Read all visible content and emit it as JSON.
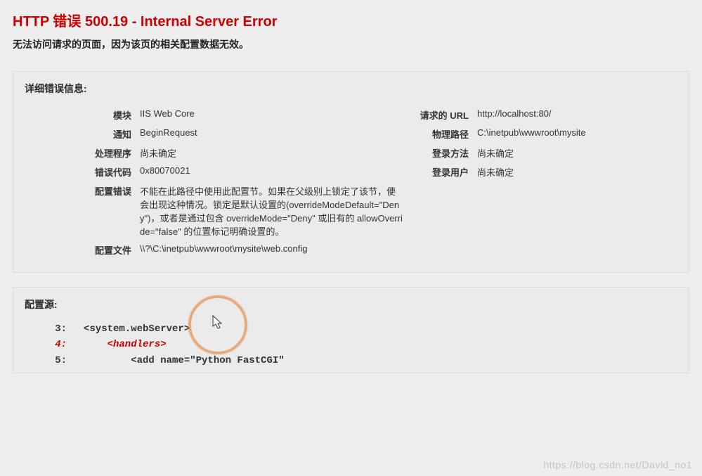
{
  "title": "HTTP 错误 500.19 - Internal Server Error",
  "subtitle": "无法访问请求的页面，因为该页的相关配置数据无效。",
  "details": {
    "heading": "详细错误信息:",
    "left": {
      "module_label": "模块",
      "module_value": "IIS Web Core",
      "notification_label": "通知",
      "notification_value": "BeginRequest",
      "handler_label": "处理程序",
      "handler_value": "尚未确定",
      "errcode_label": "错误代码",
      "errcode_value": "0x80070021",
      "cfgerr_label": "配置错误",
      "cfgerr_value": "不能在此路径中使用此配置节。如果在父级别上锁定了该节，便会出现这种情况。锁定是默认设置的(overrideModeDefault=\"Deny\")，或者是通过包含 overrideMode=\"Deny\" 或旧有的 allowOverride=\"false\" 的位置标记明确设置的。",
      "cfgfile_label": "配置文件",
      "cfgfile_value": "\\\\?\\C:\\inetpub\\wwwroot\\mysite\\web.config"
    },
    "right": {
      "requrl_label": "请求的 URL",
      "requrl_value": "http://localhost:80/",
      "physpath_label": "物理路径",
      "physpath_value": "C:\\inetpub\\wwwroot\\mysite",
      "logon_label": "登录方法",
      "logon_value": "尚未确定",
      "loguser_label": "登录用户",
      "loguser_value": "尚未确定"
    }
  },
  "config_source": {
    "heading": "配置源:",
    "lines": [
      {
        "n": "3:",
        "code": "<system.webServer>",
        "indent": 0,
        "hl": false
      },
      {
        "n": "4:",
        "code": "<handlers>",
        "indent": 1,
        "hl": true
      },
      {
        "n": "5:",
        "code": "<add name=\"Python FastCGI\"",
        "indent": 2,
        "hl": false
      }
    ]
  },
  "watermark": "https://blog.csdn.net/David_no1"
}
